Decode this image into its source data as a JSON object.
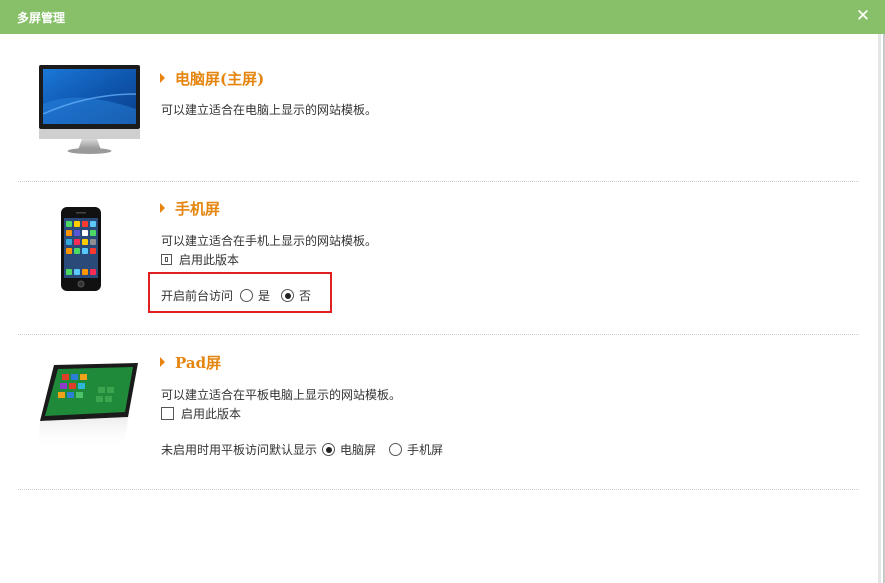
{
  "dialog": {
    "title": "多屏管理",
    "close_glyph": "✕"
  },
  "sections": {
    "pc": {
      "heading": "电脑屏(主屏)",
      "description": "可以建立适合在电脑上显示的网站模板。"
    },
    "mobile": {
      "heading": "手机屏",
      "description": "可以建立适合在手机上显示的网站模板。",
      "enable_label": "启用此版本",
      "frontend_label": "开启前台访问",
      "yes_label": "是",
      "no_label": "否",
      "frontend_selected": "否"
    },
    "pad": {
      "heading": "Pad屏",
      "description": "可以建立适合在平板电脑上显示的网站模板。",
      "enable_label": "启用此版本",
      "default_label": "未启用时用平板访问默认显示",
      "option_pc": "电脑屏",
      "option_mobile": "手机屏",
      "default_selected": "电脑屏"
    }
  },
  "colors": {
    "titlebar": "#87c068",
    "heading": "#e5850f",
    "highlight_box": "#e02020"
  }
}
